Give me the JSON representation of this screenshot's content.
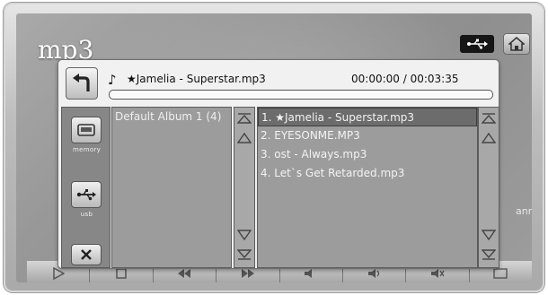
{
  "app": {
    "title": "mp3",
    "side_label": "ann"
  },
  "now_playing": {
    "note_icon": "music-note-icon",
    "title": "★Jamelia - Superstar.mp3",
    "time": "00:00:00 / 00:03:35",
    "progress": 0.0
  },
  "sources": [
    {
      "label": "memory",
      "icon": "memory-card-icon"
    },
    {
      "label": "usb",
      "icon": "usb-icon"
    }
  ],
  "albums": [
    "Default Album 1 (4)"
  ],
  "songs": [
    "1. ★Jamelia - Superstar.mp3",
    "2. EYESONME.MP3",
    "3. ost - Always.mp3",
    "4. Let`s Get Retarded.mp3"
  ],
  "selected_song_index": 0,
  "bottom_controls": [
    "play-icon",
    "stop-icon",
    "prev-icon",
    "next-icon",
    "volume-down-icon",
    "volume-up-icon",
    "mute-icon",
    "menu-icon"
  ],
  "colors": {
    "panel": "#f1f1f1",
    "list_bg": "#9c9c9c",
    "selected_row": "#6c6c6c"
  }
}
